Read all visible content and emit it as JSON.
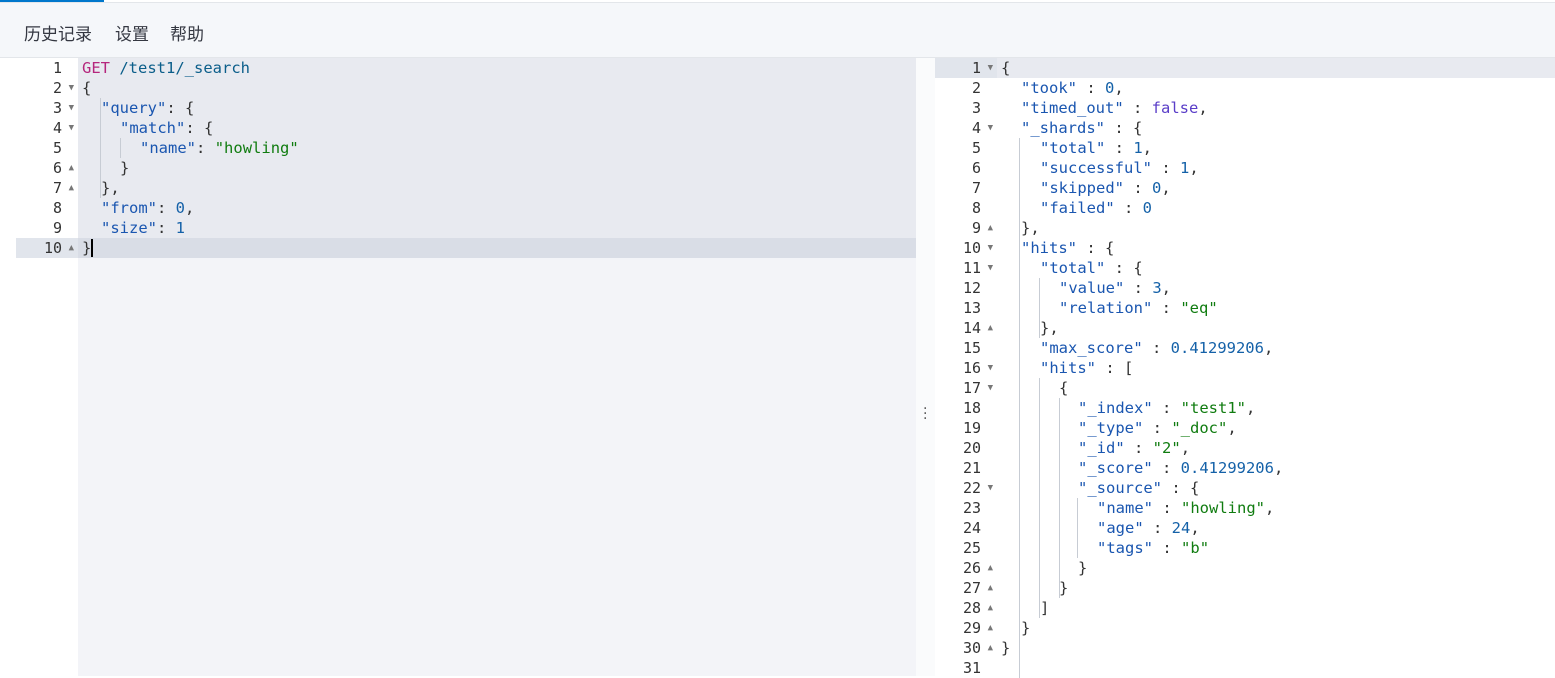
{
  "menu": {
    "history": "历史记录",
    "settings": "设置",
    "help": "帮助"
  },
  "request": {
    "lines": [
      {
        "n": "1",
        "text": "GET /test1/_search"
      },
      {
        "n": "2",
        "text": "{"
      },
      {
        "n": "3",
        "text": "\"query\": {"
      },
      {
        "n": "4",
        "text": "\"match\": {"
      },
      {
        "n": "5",
        "text": "\"name\": \"howling\""
      },
      {
        "n": "6",
        "text": "}"
      },
      {
        "n": "7",
        "text": "},"
      },
      {
        "n": "8",
        "text": "\"from\": 0,"
      },
      {
        "n": "9",
        "text": "\"size\": 1"
      },
      {
        "n": "10",
        "text": "}"
      }
    ],
    "method": "GET",
    "path": "/test1/_search",
    "query": {
      "from": 0,
      "size": 1,
      "match_field": "name",
      "match_value": "howling"
    }
  },
  "response": {
    "line_numbers": [
      "1",
      "2",
      "3",
      "4",
      "5",
      "6",
      "7",
      "8",
      "9",
      "10",
      "11",
      "12",
      "13",
      "14",
      "15",
      "16",
      "17",
      "18",
      "19",
      "20",
      "21",
      "22",
      "23",
      "24",
      "25",
      "26",
      "27",
      "28",
      "29",
      "30",
      "31"
    ],
    "took": "0",
    "timed_out": "false",
    "shards": {
      "total": "1",
      "successful": "1",
      "skipped": "0",
      "failed": "0"
    },
    "hits_total": {
      "value": "3",
      "relation": "eq"
    },
    "max_score": "0.41299206",
    "hit": {
      "_index": "test1",
      "_type": "_doc",
      "_id": "2",
      "_score": "0.41299206",
      "source": {
        "name": "howling",
        "age": "24",
        "tags": "b"
      }
    }
  },
  "icons": {
    "run": "play-icon",
    "settings": "wrench-icon",
    "resize": "vertical-dots-icon"
  },
  "colors": {
    "accent": "#0077cc",
    "method": "#b5267d",
    "string": "#107c10",
    "key": "#1a56b0"
  }
}
